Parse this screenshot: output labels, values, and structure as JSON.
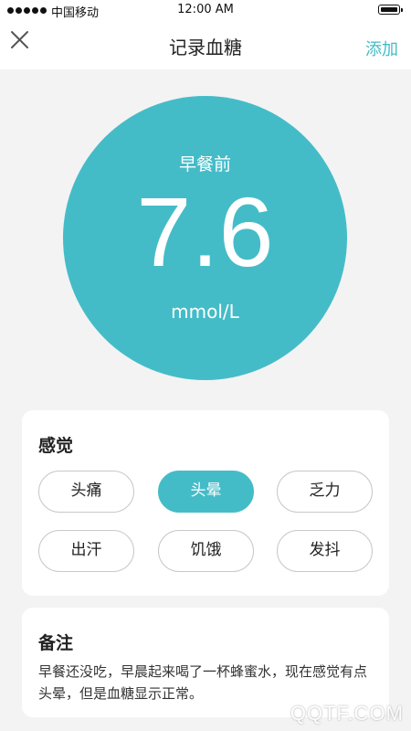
{
  "status_bar": {
    "carrier": "中国移动",
    "time": "12:00 AM"
  },
  "nav": {
    "title": "记录血糖",
    "add_label": "添加"
  },
  "reading": {
    "period": "早餐前",
    "value": "7.6",
    "unit": "mmol/L"
  },
  "feelings": {
    "title": "感觉",
    "options": [
      {
        "label": "头痛",
        "selected": false
      },
      {
        "label": "头晕",
        "selected": true
      },
      {
        "label": "乏力",
        "selected": false
      },
      {
        "label": "出汗",
        "selected": false
      },
      {
        "label": "饥饿",
        "selected": false
      },
      {
        "label": "发抖",
        "selected": false
      }
    ]
  },
  "notes": {
    "title": "备注",
    "text": "早餐还没吃，早晨起来喝了一杯蜂蜜水，现在感觉有点头晕，但是血糖显示正常。"
  },
  "watermark": "QQTF.COM",
  "colors": {
    "accent": "#44bcc8",
    "background": "#f3f3f3"
  }
}
